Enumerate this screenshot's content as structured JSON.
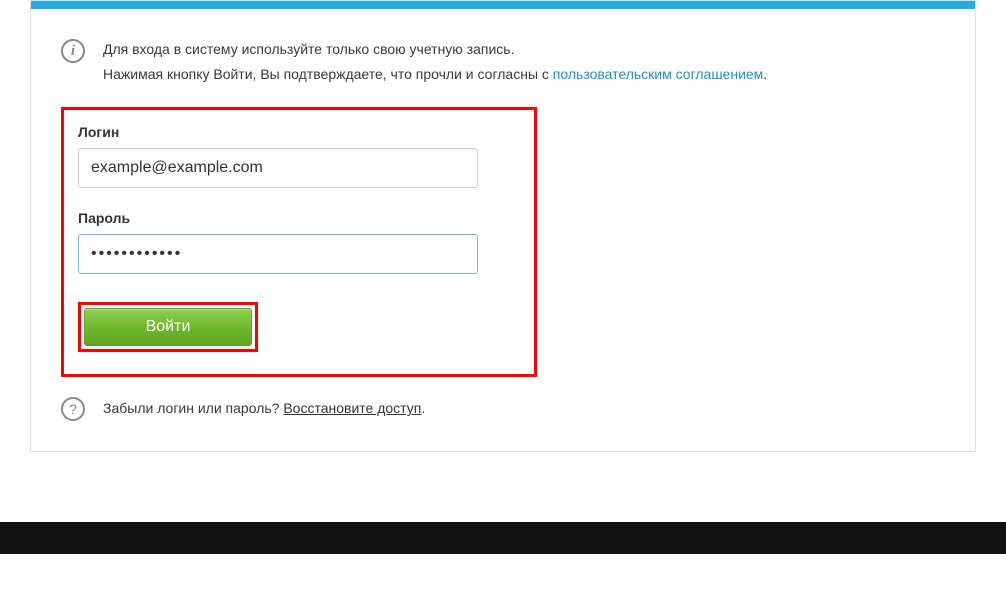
{
  "info": {
    "line1": "Для входа в систему используйте только свою учетную запись.",
    "line2_prefix": "Нажимая кнопку Войти, Вы подтверждаете, что прочли и согласны с ",
    "agreement_link": "пользовательским соглашением",
    "line2_suffix": "."
  },
  "form": {
    "login_label": "Логин",
    "login_value": "example@example.com",
    "password_label": "Пароль",
    "password_value": "••••••••••••",
    "submit_label": "Войти"
  },
  "footer": {
    "prefix": "Забыли логин или пароль? ",
    "link": "Восстановите доступ",
    "suffix": "."
  }
}
